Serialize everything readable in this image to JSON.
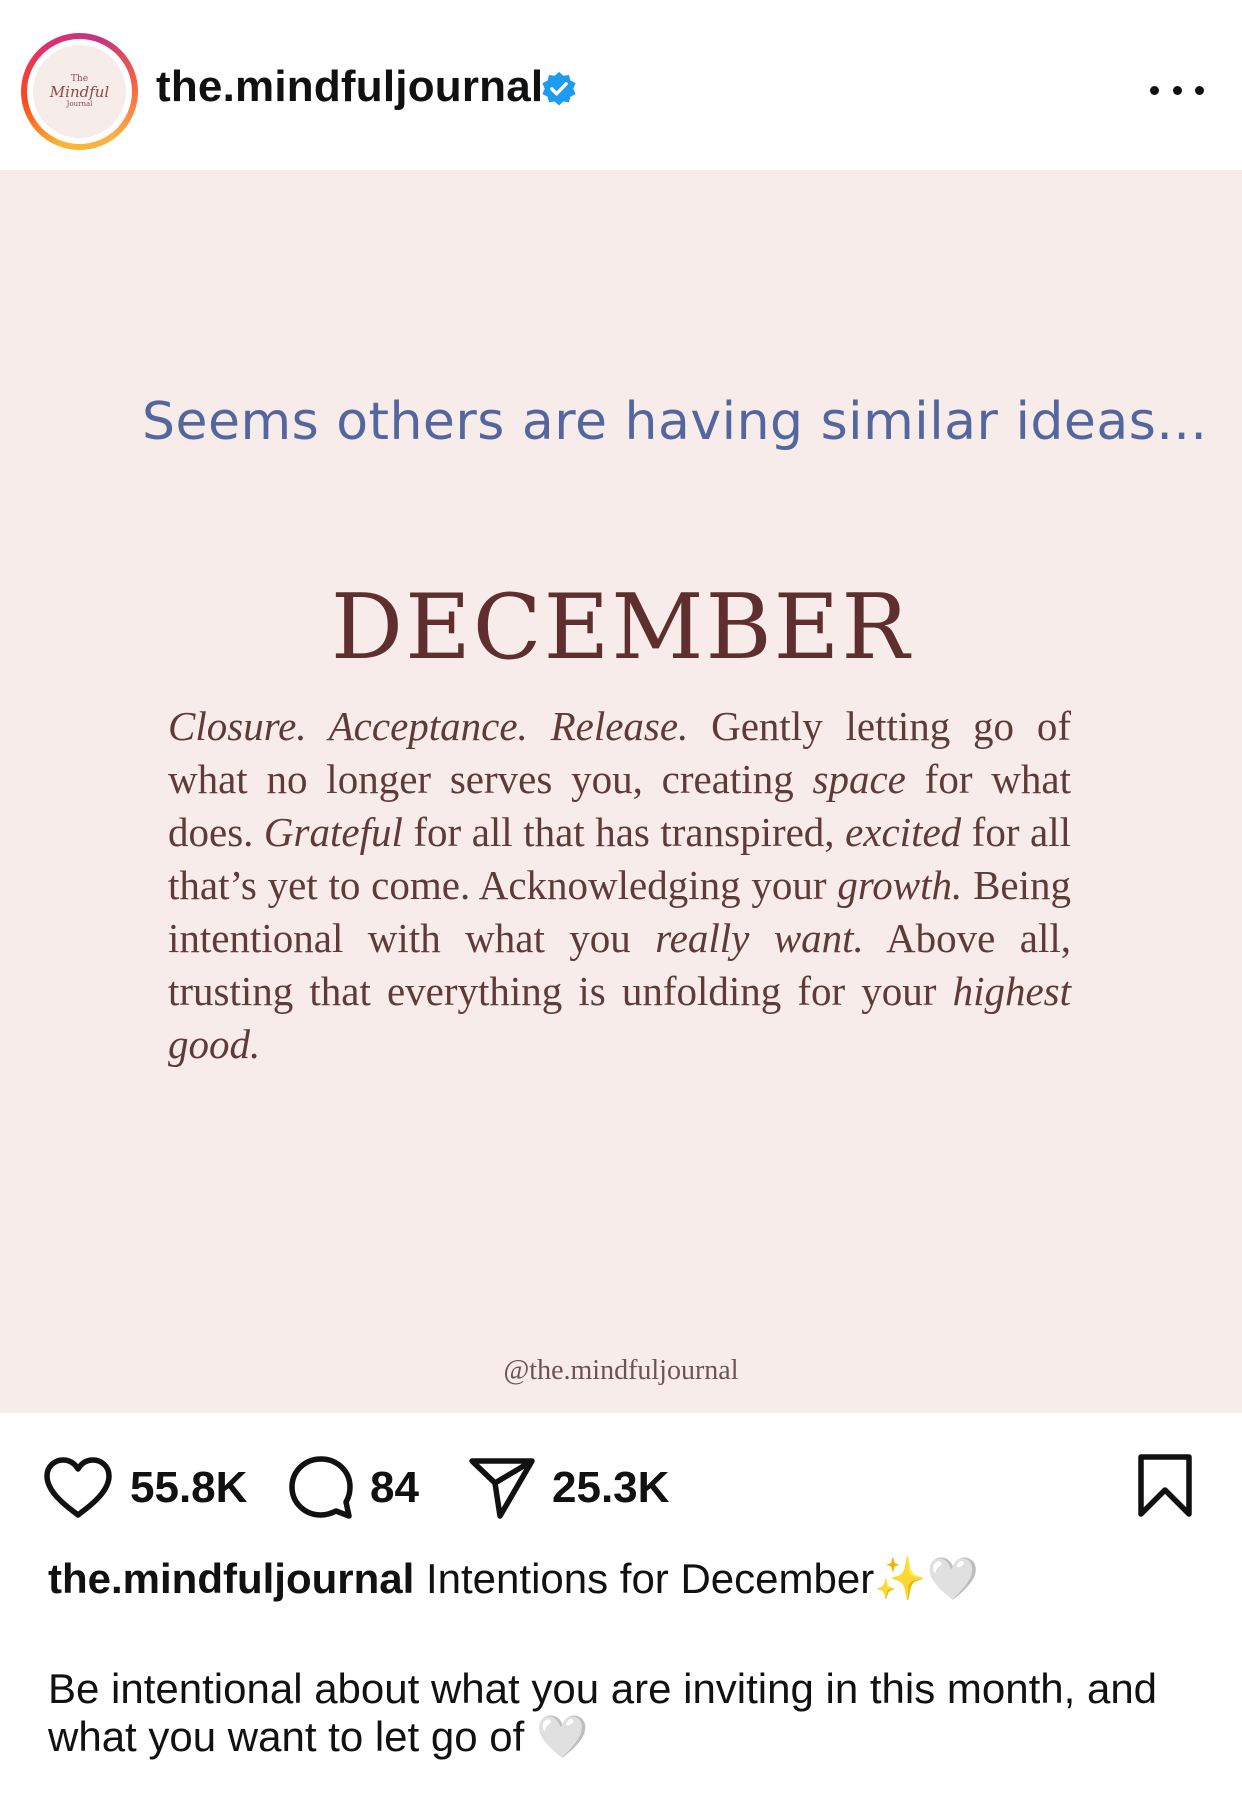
{
  "header": {
    "username": "the.mindfuljournal",
    "avatar_text": [
      "The",
      "Mindful",
      "Journal"
    ],
    "verified_icon": "verified-badge-icon",
    "more_icon": "more-options-icon",
    "ring_colors": [
      "#f7b733",
      "#fc4a1a",
      "#e1306c",
      "#c13584"
    ]
  },
  "post": {
    "overlay_text": "Seems others are having similar ideas...",
    "title": "DECEMBER",
    "body": {
      "p1": "Closure. Acceptance. Release.",
      "p2": " Gently letting go of what no longer serves you, creating ",
      "p3": "space",
      "p4": " for what does. ",
      "p5": "Grateful",
      "p6": " for all that has transpired, ",
      "p7": "excited",
      "p8": " for all that’s yet to come. Acknowledging your ",
      "p9": "growth.",
      "p10": " Being intentional with what you ",
      "p11": "really want.",
      "p12": " Above all, trusting that everything is unfolding for your ",
      "p13": "highest good."
    },
    "handle": "@the.mindfuljournal",
    "background_color": "#f7ece9",
    "overlay_color": "#53669e",
    "title_color": "#5e2f2e"
  },
  "actions": {
    "likes": "55.8K",
    "comments": "84",
    "shares": "25.3K",
    "icons": [
      "heart-icon",
      "comment-icon",
      "share-icon",
      "bookmark-icon"
    ]
  },
  "caption": {
    "username": "the.mindfuljournal",
    "text": " Intentions for December✨🤍",
    "body": "Be intentional about what you are inviting in this month, and what you want to let go of 🤍"
  }
}
